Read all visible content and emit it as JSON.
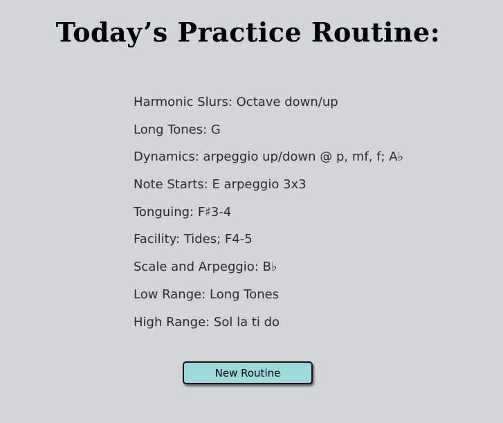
{
  "title": "Today’s Practice Routine:",
  "routine": [
    {
      "text": "Harmonic Slurs: Octave down/up"
    },
    {
      "text": "Long Tones: G"
    },
    {
      "text": "Dynamics: arpeggio up/down @ p, mf, f; A♭"
    },
    {
      "text": "Note Starts: E arpeggio 3x3"
    },
    {
      "text": "Tonguing: F♯3-4"
    },
    {
      "text": "Facility: Tides; F4-5"
    },
    {
      "text": "Scale and Arpeggio: B♭"
    },
    {
      "text": "Low Range: Long Tones"
    },
    {
      "text": "High Range: Sol la ti do"
    }
  ],
  "button": {
    "label": "New Routine"
  },
  "colors": {
    "background": "#d2d6d7",
    "button": "#9cd9d9"
  }
}
